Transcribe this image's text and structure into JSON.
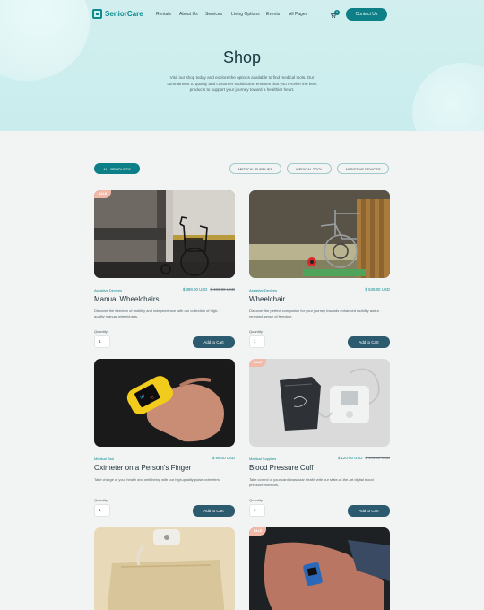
{
  "brand": {
    "name_part1": "Senior",
    "name_part2": "Care",
    "logo_icon": "house-cross-icon"
  },
  "nav": {
    "items": [
      "Rentals",
      "About Us",
      "Services",
      "Living Options",
      "Events",
      "All Pages"
    ]
  },
  "cart": {
    "count": "0",
    "icon": "cart-icon"
  },
  "header": {
    "contact_label": "Contact Us"
  },
  "hero": {
    "title": "Shop",
    "description": "Visit our shop today and explore the options available to find medical tools. Our commitment to quality and customer satisfaction ensures that you receive the best products to support your journey toward a healthier heart."
  },
  "filters": [
    {
      "label": "ALL PRODUCTS",
      "active": true
    },
    {
      "label": "MEDICAL SUPPLIES",
      "active": false
    },
    {
      "label": "MEDICAL TOOL",
      "active": false
    },
    {
      "label": "ASSISTIVE DEVICES",
      "active": false
    }
  ],
  "sale_label": "SALE",
  "quantity_label": "Quantity",
  "add_to_cart_label": "Add to Cart",
  "products": [
    {
      "category": "Assistive Devices",
      "price": "$ 399.00 USD",
      "old_price": "$ 499.00 USD",
      "title": "Manual Wheelchairs",
      "description": "Discover the freedom of mobility and independence with our collection of high-quality manual wheelchairs.",
      "quantity": "1",
      "sale": true
    },
    {
      "category": "Assistive Devices",
      "price": "$ 539.00 USD",
      "old_price": "",
      "title": "Wheelchair",
      "description": "Discover the perfect companion for your journey towards enhanced mobility and a renewed sense of freedom.",
      "quantity": "1",
      "sale": false
    },
    {
      "category": "Medical Tool",
      "price": "$ 99.00 USD",
      "old_price": "",
      "title": "Oximeter on a Person's Finger",
      "description": "Take charge of your health and well-being with our high-quality pulse oximeters.",
      "quantity": "1",
      "sale": false
    },
    {
      "category": "Medical Supplies",
      "price": "$ 120.00 USD",
      "old_price": "$ 149.00 USD",
      "title": "Blood Pressure Cuff",
      "description": "Take control of your cardiovascular health with our state-of-the-art digital blood pressure monitors.",
      "quantity": "1",
      "sale": true
    },
    {
      "category": "",
      "price": "",
      "old_price": "",
      "title": "",
      "description": "",
      "quantity": "",
      "sale": false
    },
    {
      "category": "",
      "price": "",
      "old_price": "",
      "title": "",
      "description": "",
      "quantity": "",
      "sale": true
    }
  ]
}
